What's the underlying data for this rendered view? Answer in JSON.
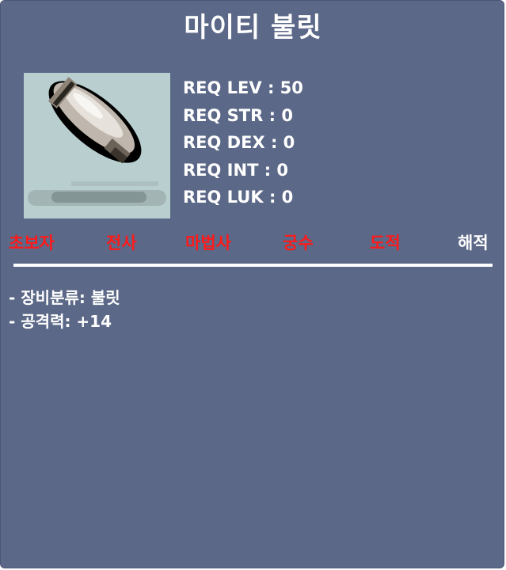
{
  "item": {
    "name": "마이티 불릿",
    "icon": "bullet-item-icon"
  },
  "requirements": [
    {
      "label": "REQ LEV : 50"
    },
    {
      "label": "REQ STR : 0"
    },
    {
      "label": "REQ DEX : 0"
    },
    {
      "label": "REQ INT : 0"
    },
    {
      "label": "REQ LUK : 0"
    }
  ],
  "jobs": [
    {
      "label": "초보자",
      "available": false
    },
    {
      "label": "전사",
      "available": false
    },
    {
      "label": "마법사",
      "available": false
    },
    {
      "label": "궁수",
      "available": false
    },
    {
      "label": "도적",
      "available": false
    },
    {
      "label": "해적",
      "available": true
    }
  ],
  "details": [
    {
      "text": "- 장비분류: 불릿"
    },
    {
      "text": "- 공격력: +14"
    }
  ],
  "colors": {
    "panel_bg": "#5b6887",
    "icon_bg": "#b9cfcf",
    "job_unavailable": "#ff1a1a",
    "job_available": "#ffffff"
  }
}
